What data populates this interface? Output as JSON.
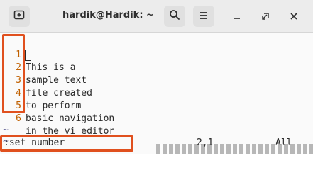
{
  "window": {
    "title": "hardik@Hardik: ~",
    "buttons": {
      "new_tab_icon": "new-tab-icon",
      "search_icon": "search-icon",
      "menu_icon": "hamburger-menu-icon",
      "minimize": "–",
      "maximize": "□",
      "close": "✕"
    }
  },
  "editor": {
    "lines": [
      {
        "number": "1",
        "text": "This is a"
      },
      {
        "number": "2",
        "text": "sample text"
      },
      {
        "number": "3",
        "text": "file created"
      },
      {
        "number": "4",
        "text": "to perform"
      },
      {
        "number": "5",
        "text": "basic navigation"
      },
      {
        "number": "6",
        "text": "in the vi editor"
      }
    ],
    "tildes": [
      "~",
      "~"
    ],
    "cursor": {
      "line": 2,
      "col": 1
    }
  },
  "status": {
    "command": ":set number",
    "position": "2,1",
    "scroll": "All"
  },
  "colors": {
    "highlight": "#e0501e",
    "line_number": "#c06000"
  }
}
